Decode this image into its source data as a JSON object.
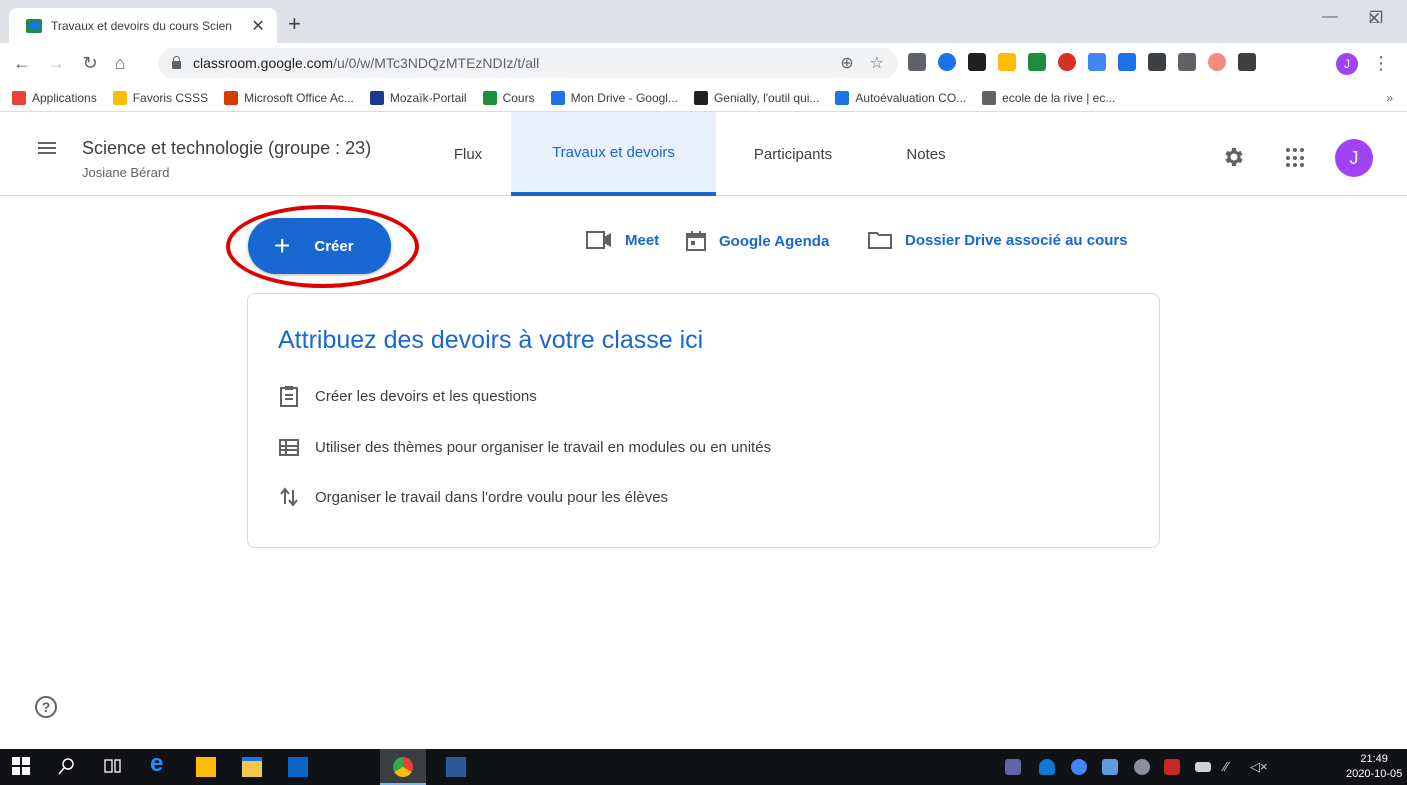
{
  "browser": {
    "tab_title": "Travaux et devoirs du cours Scien",
    "tab_close": "✕",
    "new_tab": "+",
    "url_host": "classroom.google.com",
    "url_path": "/u/0/w/MTc3NDQzMTEzNDIz/t/all",
    "profile_initial": "J",
    "bookmarks": [
      {
        "label": "Applications",
        "color": "#ea4335"
      },
      {
        "label": "Favoris CSSS",
        "color": "#fbbc04"
      },
      {
        "label": "Microsoft Office Ac...",
        "color": "#d83b01"
      },
      {
        "label": "Mozaïk-Portail",
        "color": "#1a3a8f"
      },
      {
        "label": "Cours",
        "color": "#1e8e3e"
      },
      {
        "label": "Mon Drive - Googl...",
        "color": "#1a73e8"
      },
      {
        "label": "Genially, l'outil qui...",
        "color": "#202124"
      },
      {
        "label": "Autoévaluation CO...",
        "color": "#1a73e8"
      },
      {
        "label": "ecole de la rive | ec...",
        "color": "#5f6368"
      }
    ],
    "bookmarks_more": "»"
  },
  "header": {
    "course_title": "Science et technologie (groupe : 23)",
    "teacher": "Josiane Bérard",
    "tabs": [
      {
        "label": "Flux"
      },
      {
        "label": "Travaux et devoirs"
      },
      {
        "label": "Participants"
      },
      {
        "label": "Notes"
      }
    ],
    "avatar_initial": "J"
  },
  "main": {
    "create_label": "Créer",
    "links": {
      "meet": "Meet",
      "agenda": "Google Agenda",
      "drive": "Dossier Drive associé au cours"
    },
    "card": {
      "title": "Attribuez des devoirs à votre classe ici",
      "items": [
        "Créer les devoirs et les questions",
        "Utiliser des thèmes pour organiser le travail en modules ou en unités",
        "Organiser le travail dans l'ordre voulu pour les élèves"
      ]
    },
    "help": "?"
  },
  "taskbar": {
    "time": "21:49",
    "date": "2020-10-05"
  },
  "colors": {
    "accent": "#1967d2",
    "highlight": "#e00000",
    "avatar": "#a142f4"
  }
}
